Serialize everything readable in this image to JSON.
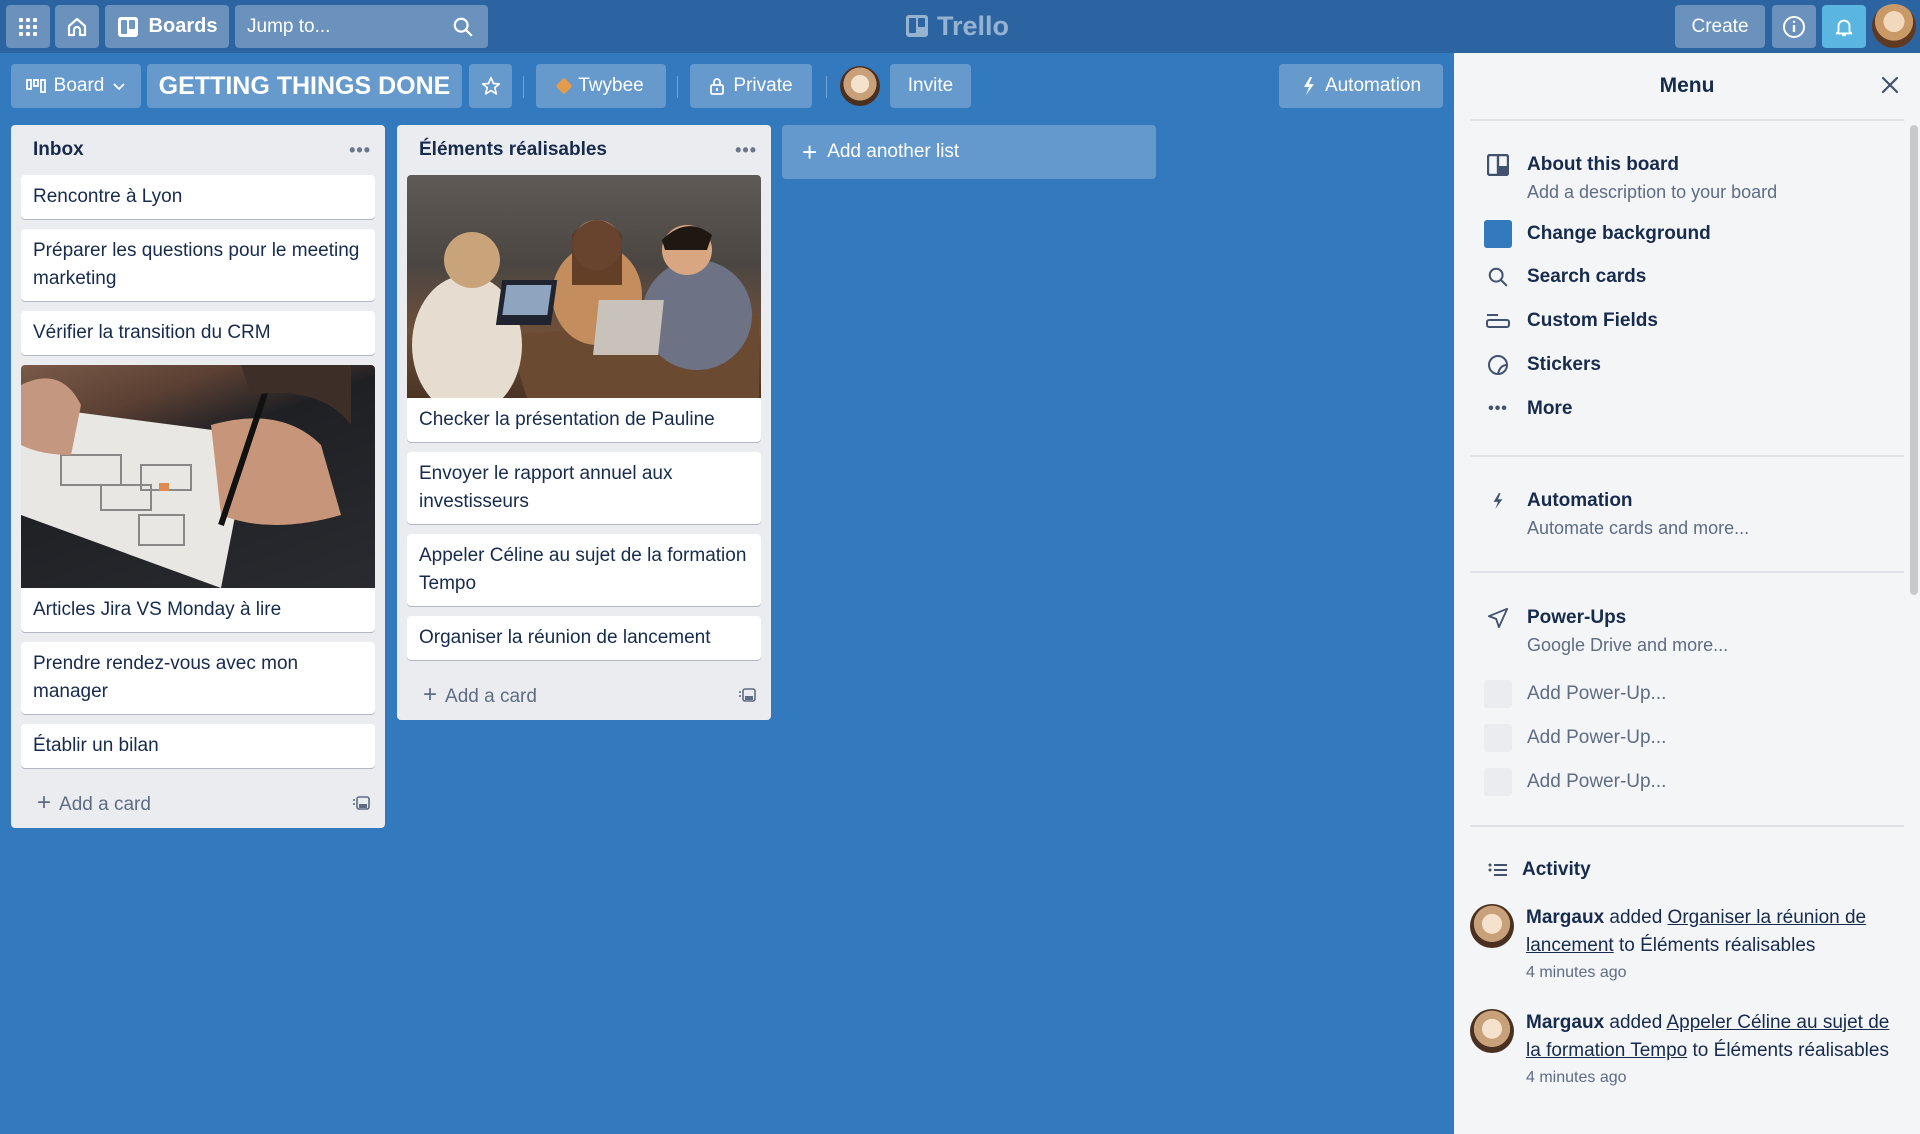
{
  "topbar": {
    "boards_label": "Boards",
    "search_placeholder": "Jump to...",
    "logo_text": "Trello",
    "create_label": "Create"
  },
  "board_header": {
    "view_label": "Board",
    "board_title": "GETTING THINGS DONE",
    "team_label": "Twybee",
    "visibility_label": "Private",
    "invite_label": "Invite",
    "automation_label": "Automation"
  },
  "lists": [
    {
      "title": "Inbox",
      "cards": [
        {
          "text": "Rencontre à Lyon"
        },
        {
          "text": "Préparer les questions pour le meeting marketing"
        },
        {
          "text": "Vérifier la transition du CRM"
        },
        {
          "text": "Articles Jira VS Monday à lire",
          "cover": "hand-sketching-wireframe"
        },
        {
          "text": "Prendre rendez-vous avec mon manager"
        },
        {
          "text": "Établir un bilan"
        }
      ],
      "add_card_label": "Add a card"
    },
    {
      "title": "Éléments réalisables",
      "cards": [
        {
          "text": "Checker la présentation de Pauline",
          "cover": "team-meeting-with-laptops"
        },
        {
          "text": "Envoyer le rapport annuel aux investisseurs"
        },
        {
          "text": "Appeler Céline au sujet de la formation Tempo"
        },
        {
          "text": "Organiser la réunion de lancement"
        }
      ],
      "add_card_label": "Add a card"
    }
  ],
  "add_list_label": "Add another list",
  "menu": {
    "title": "Menu",
    "items": [
      {
        "title": "About this board",
        "subtitle": "Add a description to your board",
        "icon": "board-icon"
      },
      {
        "title": "Change background",
        "icon": "color-swatch",
        "color": "#3379bd"
      },
      {
        "title": "Search cards",
        "icon": "search-icon"
      },
      {
        "title": "Custom Fields",
        "icon": "custom-fields-icon"
      },
      {
        "title": "Stickers",
        "icon": "sticker-icon"
      },
      {
        "title": "More",
        "icon": "more-icon"
      }
    ],
    "automation": {
      "title": "Automation",
      "subtitle": "Automate cards and more..."
    },
    "powerups": {
      "title": "Power-Ups",
      "subtitle": "Google Drive and more...",
      "slots": [
        "Add Power-Up...",
        "Add Power-Up...",
        "Add Power-Up..."
      ]
    },
    "activity": {
      "title": "Activity",
      "entries": [
        {
          "user": "Margaux",
          "action": "added",
          "card": "Organiser la réunion de lancement",
          "connector": "to",
          "list": "Éléments réalisables",
          "time": "4 minutes ago"
        },
        {
          "user": "Margaux",
          "action": "added",
          "card": "Appeler Céline au sujet de la formation Tempo",
          "connector": "to",
          "list": "Éléments réalisables",
          "time": "4 minutes ago"
        }
      ]
    }
  }
}
